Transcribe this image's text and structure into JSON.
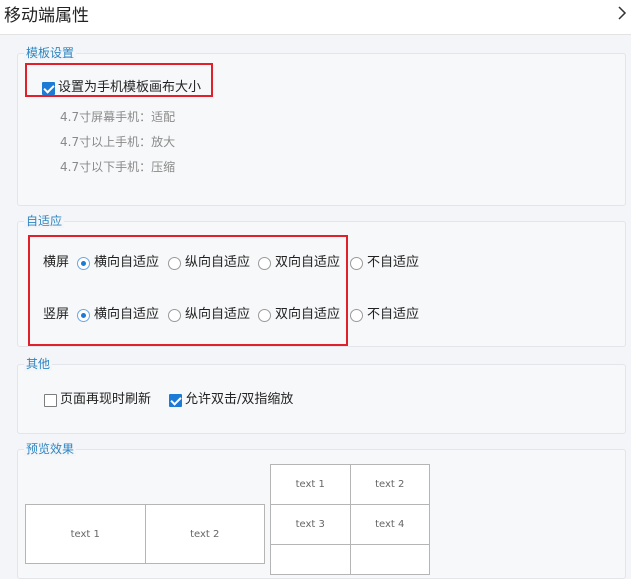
{
  "dialog": {
    "title": "移动端属性",
    "close_icon": "close-icon"
  },
  "template": {
    "legend": "模板设置",
    "checkbox_label": "设置为手机模板画布大小",
    "checked": true,
    "hints": [
      "4.7寸屏幕手机：适配",
      "4.7寸以上手机：放大",
      "4.7寸以下手机：压缩"
    ]
  },
  "adaptive": {
    "legend": "自适应",
    "rows": [
      {
        "label": "横屏",
        "options": [
          "横向自适应",
          "纵向自适应",
          "双向自适应",
          "不自适应"
        ],
        "selected": 0
      },
      {
        "label": "竖屏",
        "options": [
          "横向自适应",
          "纵向自适应",
          "双向自适应",
          "不自适应"
        ],
        "selected": 0
      }
    ]
  },
  "other": {
    "legend": "其他",
    "refresh_label": "页面再现时刷新",
    "refresh_checked": false,
    "zoom_label": "允许双击/双指缩放",
    "zoom_checked": true
  },
  "preview": {
    "legend": "预览效果",
    "landscape_cells": [
      "text 1",
      "text 2"
    ],
    "portrait_cells": [
      "text 1",
      "text 2",
      "text 3",
      "text 4"
    ]
  },
  "colors": {
    "accent": "#1d7bd6",
    "legend": "#2e86c1",
    "highlight": "#e0202a"
  }
}
